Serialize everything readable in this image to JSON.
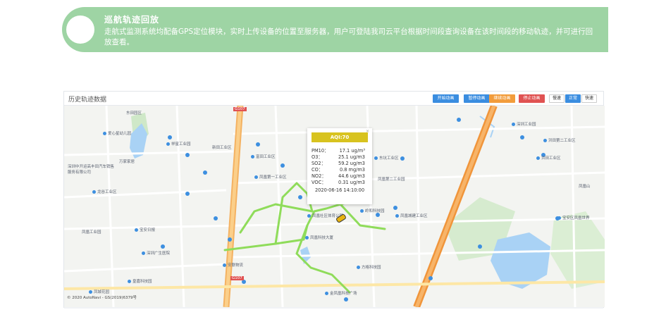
{
  "banner": {
    "title": "巡航轨迹回放",
    "description": "走航式监测系统均配备GPS定位模块，实时上传设备的位置至服务器，用户可登陆我司云平台根据时间段查询设备在该时间段的移动轨迹，并可进行回放查看。"
  },
  "panel": {
    "title": "历史轨迹数据",
    "buttons": {
      "start": "开始动画",
      "pause": "暂停动画",
      "resume": "继续动画",
      "stop": "停止动画",
      "slow": "慢速",
      "normal": "正常",
      "fast": "快速"
    }
  },
  "popup": {
    "header": "AQI:70",
    "close": "×",
    "rows": [
      {
        "k": "PM10：",
        "v": "17.1 ug/m³"
      },
      {
        "k": "O3：",
        "v": "25.1 ug/m3"
      },
      {
        "k": "SO2：",
        "v": "59.2 ug/m3"
      },
      {
        "k": "CO：",
        "v": "0.8 mg/m3"
      },
      {
        "k": "NO2：",
        "v": "44.6 ug/m3"
      },
      {
        "k": "VOC：",
        "v": "0.31 ug/m3"
      }
    ],
    "time": "2020-06-16 14:10:00"
  },
  "map": {
    "copyright": "© 2020 AutoNavi - GS(2019)6379号",
    "labels": [
      "东田园区",
      "爱心星幼儿园",
      "深圳中开运高丰田汽车销售服务有限公司",
      "万家家居",
      "前汇苑",
      "龙谷工业区",
      "深圳市",
      "祥星工业园",
      "新田工业区",
      "富田工业区",
      "凤凰第一工业区",
      "凤凰体育公园",
      "森达小区",
      "凤凰社区体育公园",
      "凤凰科技大厦",
      "凤凰第二工业园",
      "东坑工业区",
      "岭和科技园",
      "凤凰城建工业区",
      "深圳市园地工业区",
      "宝安区凤凰世界",
      "凤凰山",
      "洪田山",
      "洪田社区",
      "洪田第二工业区",
      "洪田工业区",
      "凤凰山公园",
      "深圳工业园",
      "凤凰工业园",
      "福永凤凰区",
      "兴围凤凰大厦",
      "凤城花园",
      "福安街道",
      "金凤凰科技广场",
      "白石龙公园",
      "福永凤凰社区",
      "凤凰三宝",
      "凤凰科技",
      "方格科技园",
      "欧辉工业园",
      "福瑞工业区",
      "凤凰广场",
      "安联物流",
      "凤凰广场社区",
      "深圳广生医院",
      "福永街道",
      "凤凰医院",
      "福永工业园",
      "皇嘉科技园",
      "宝安日报",
      "G107",
      "金凯工业园"
    ]
  }
}
